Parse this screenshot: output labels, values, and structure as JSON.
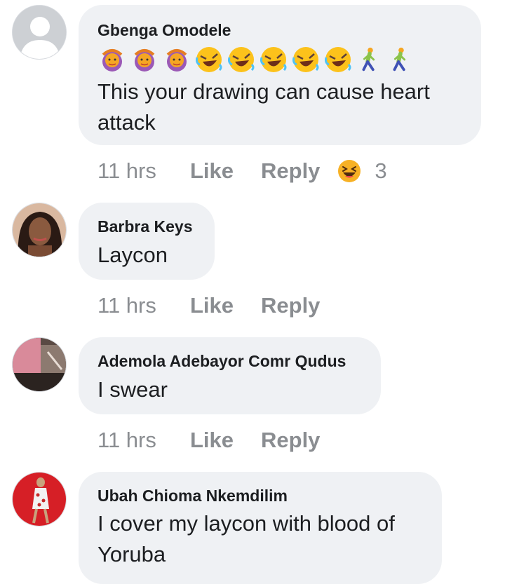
{
  "comments": [
    {
      "author": "Gbenga Omodele",
      "emojis": [
        "woman-gesturing-ok",
        "woman-gesturing-ok",
        "woman-gesturing-ok",
        "rolling-on-floor-laughing",
        "rolling-on-floor-laughing",
        "rolling-on-floor-laughing",
        "rolling-on-floor-laughing",
        "rolling-on-floor-laughing",
        "man-walking",
        "man-walking"
      ],
      "text": "This your drawing can cause heart attack",
      "time": "11 hrs",
      "like": "Like",
      "reply": "Reply",
      "reaction_icon": "laughing-face",
      "reaction_count": "3"
    },
    {
      "author": "Barbra Keys",
      "text": "Laycon",
      "time": "11 hrs",
      "like": "Like",
      "reply": "Reply"
    },
    {
      "author": "Ademola Adebayor Comr Qudus",
      "text": "I swear",
      "time": "11 hrs",
      "like": "Like",
      "reply": "Reply"
    },
    {
      "author": "Ubah Chioma Nkemdilim",
      "text": "I cover my laycon with blood of Yoruba"
    }
  ],
  "colors": {
    "bubble": "#eff1f4",
    "text": "#1c1e21",
    "meta": "#8a8d91"
  }
}
